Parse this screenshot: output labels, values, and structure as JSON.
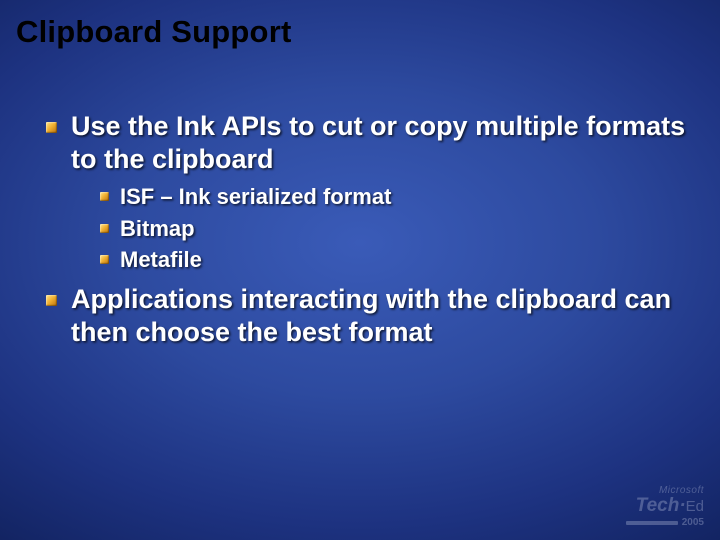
{
  "title": "Clipboard Support",
  "bullets": {
    "b1": "Use the Ink APIs to cut or copy multiple formats to the clipboard",
    "sub": {
      "s1": "ISF – Ink serialized format",
      "s2": "Bitmap",
      "s3": "Metafile"
    },
    "b2": "Applications interacting with the clipboard can then choose the best format"
  },
  "footer": {
    "company": "Microsoft",
    "brand_a": "Tech·",
    "brand_b": "Ed",
    "year": "2005"
  }
}
